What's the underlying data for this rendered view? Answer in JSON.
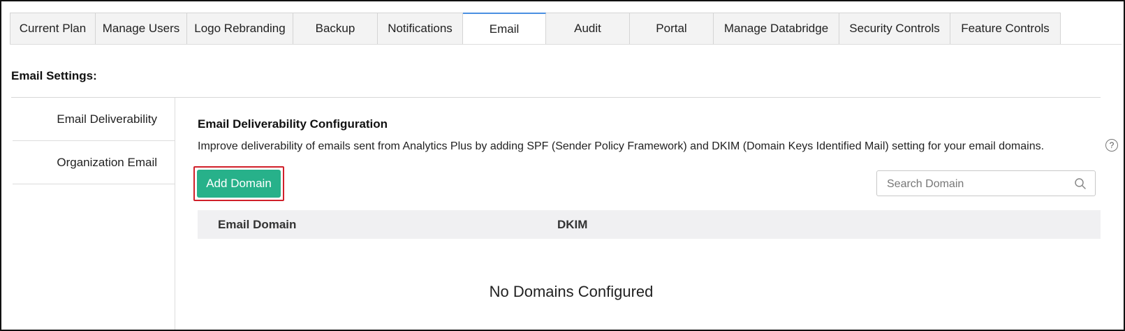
{
  "tabs": [
    {
      "label": "Current Plan",
      "active": false
    },
    {
      "label": "Manage Users",
      "active": false
    },
    {
      "label": "Logo Rebranding",
      "active": false
    },
    {
      "label": "Backup",
      "active": false
    },
    {
      "label": "Notifications",
      "active": false
    },
    {
      "label": "Email",
      "active": true
    },
    {
      "label": "Audit",
      "active": false
    },
    {
      "label": "Portal",
      "active": false
    },
    {
      "label": "Manage Databridge",
      "active": false
    },
    {
      "label": "Security Controls",
      "active": false
    },
    {
      "label": "Feature Controls",
      "active": false
    }
  ],
  "section_title": "Email Settings:",
  "sidenav": {
    "items": [
      {
        "label": "Email Deliverability"
      },
      {
        "label": "Organization Email"
      }
    ]
  },
  "main": {
    "title": "Email Deliverability Configuration",
    "description": "Improve deliverability of emails sent from Analytics Plus by adding SPF (Sender Policy Framework) and DKIM (Domain Keys Identified Mail) setting for your email domains.",
    "help_icon_glyph": "?",
    "add_button_label": "Add Domain",
    "search_placeholder": "Search Domain",
    "table": {
      "columns": [
        "Email Domain",
        "DKIM"
      ]
    },
    "empty_message": "No Domains Configured"
  },
  "colors": {
    "accent_button": "#27b18a",
    "highlight_border": "#d0202a",
    "active_tab_top": "#4a90e2"
  }
}
